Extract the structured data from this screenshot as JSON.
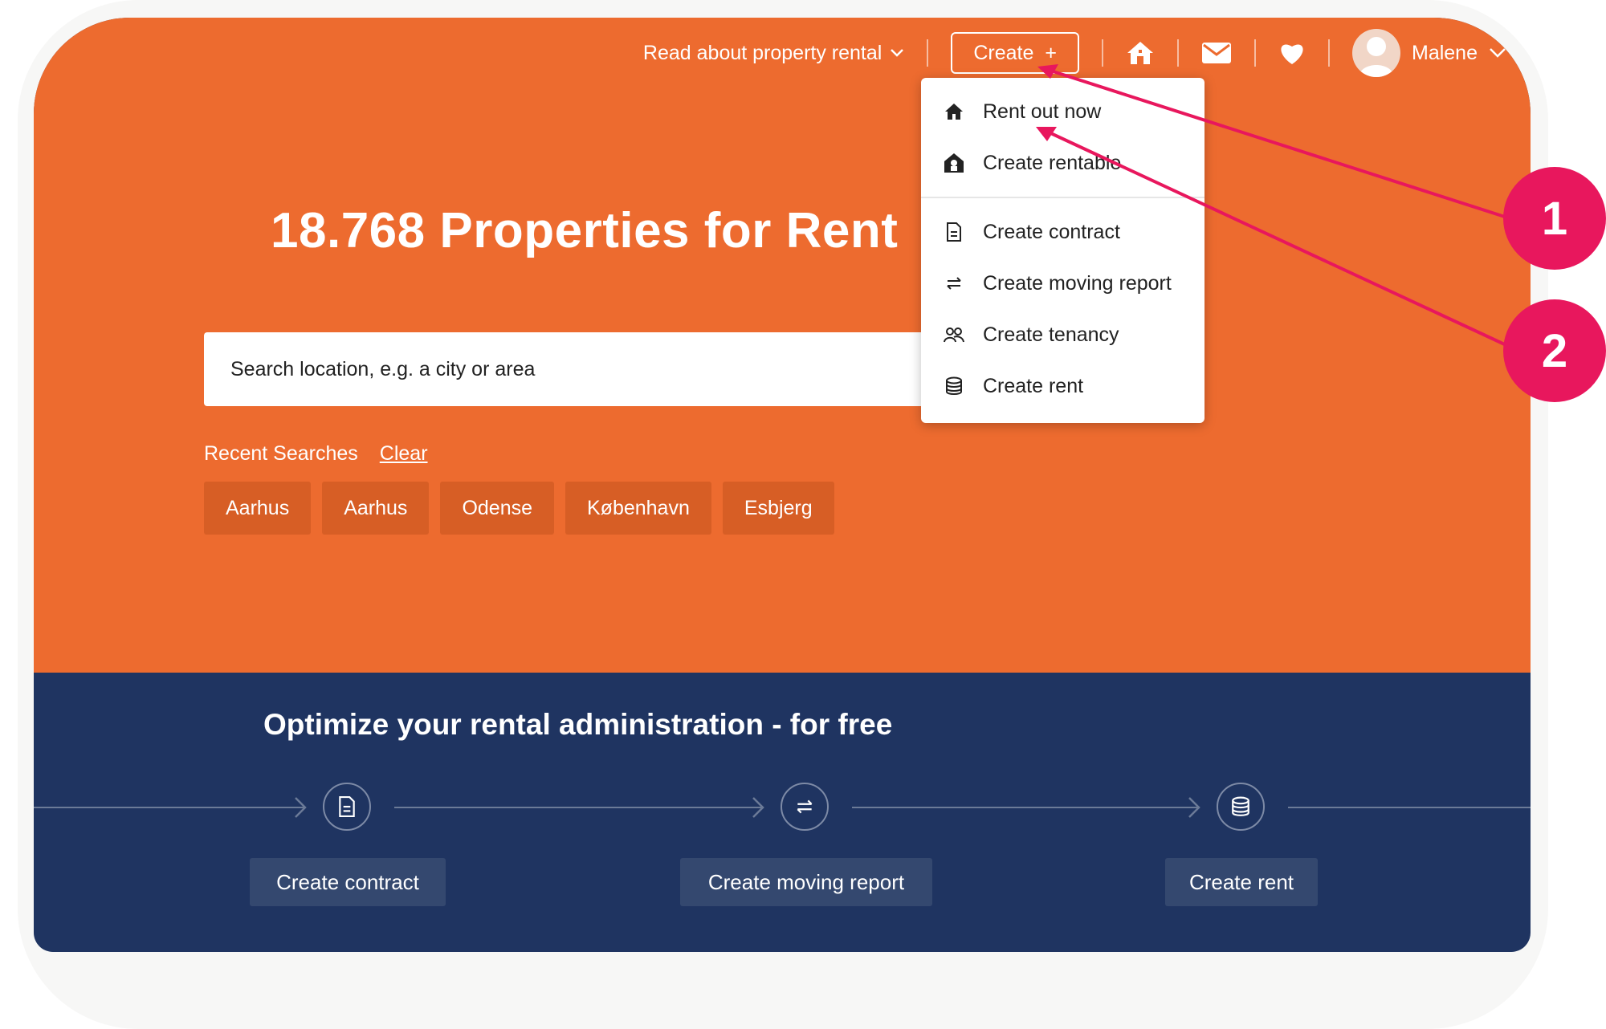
{
  "nav": {
    "read_about": "Read about property rental",
    "create": "Create",
    "create_plus": "+",
    "user_name": "Malene"
  },
  "dropdown": {
    "items": [
      {
        "label": "Rent out now",
        "icon": "house-icon"
      },
      {
        "label": "Create rentable",
        "icon": "home-lock-icon"
      },
      {
        "label": "Create contract",
        "icon": "document-icon"
      },
      {
        "label": "Create moving report",
        "icon": "swap-arrows-icon"
      },
      {
        "label": "Create tenancy",
        "icon": "people-icon"
      },
      {
        "label": "Create rent",
        "icon": "coins-stack-icon"
      }
    ]
  },
  "hero": {
    "title": "18.768 Properties for Rent",
    "search_placeholder": "Search location, e.g. a city or area",
    "recent_label": "Recent Searches",
    "clear_label": "Clear",
    "recent_chips": [
      "Aarhus",
      "Aarhus",
      "Odense",
      "København",
      "Esbjerg"
    ]
  },
  "band": {
    "title": "Optimize your rental administration - for free",
    "steps": [
      {
        "label": "Create contract",
        "icon": "document-icon"
      },
      {
        "label": "Create moving report",
        "icon": "swap-arrows-icon"
      },
      {
        "label": "Create rent",
        "icon": "coins-stack-icon"
      }
    ]
  },
  "annotations": {
    "badge1": "1",
    "badge2": "2",
    "color": "#e8175d"
  },
  "colors": {
    "hero_orange": "#ed6b2f",
    "band_navy": "#1f3461",
    "chip": "#d75e25",
    "button_navy": "#34486f"
  }
}
